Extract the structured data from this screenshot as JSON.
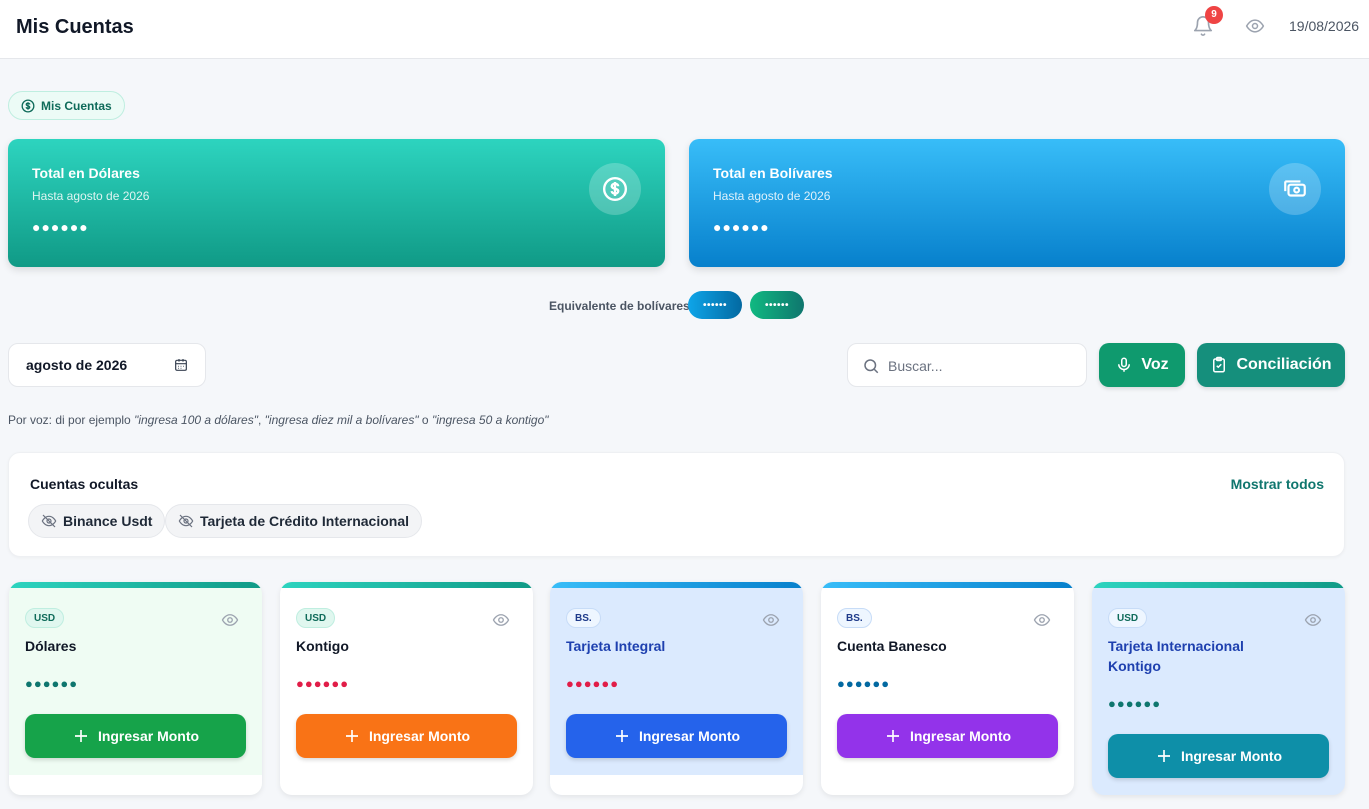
{
  "header": {
    "title": "Mis Cuentas",
    "notification_count": "9",
    "date": "19/08/2026"
  },
  "section_chip": {
    "label": "Mis Cuentas"
  },
  "totals": {
    "usd": {
      "title": "Total en Dólares",
      "subtitle": "Hasta agosto de 2026",
      "value": "●●●●●●"
    },
    "bs": {
      "title": "Total en Bolívares",
      "subtitle": "Hasta agosto de 2026",
      "value": "●●●●●●"
    }
  },
  "equivalent": {
    "label": "Equivalente de bolívares",
    "pill_a": "••••••",
    "pill_b": "••••••"
  },
  "toolbar": {
    "month": "agosto de 2026",
    "search_placeholder": "Buscar...",
    "voice_label": "Voz",
    "reconcile_label": "Conciliación"
  },
  "hint": {
    "prefix": "Por voz: di por ejemplo ",
    "ex1": "\"ingresa 100 a dólares\"",
    "sep1": ", ",
    "ex2": "\"ingresa diez mil a bolívares\"",
    "sep2": " o ",
    "ex3": "\"ingresa 50 a kontigo\""
  },
  "hidden_accounts": {
    "title": "Cuentas ocultas",
    "show_all": "Mostrar todos",
    "items": [
      "Binance Usdt",
      "Tarjeta de Crédito Internacional"
    ]
  },
  "accounts": [
    {
      "currency": "USD",
      "name": "Dólares",
      "value": "●●●●●●",
      "button": "Ingresar Monto"
    },
    {
      "currency": "USD",
      "name": "Kontigo",
      "value": "●●●●●●",
      "button": "Ingresar Monto"
    },
    {
      "currency": "BS.",
      "name": "Tarjeta Integral",
      "value": "●●●●●●",
      "button": "Ingresar Monto"
    },
    {
      "currency": "BS.",
      "name": "Cuenta Banesco",
      "value": "●●●●●●",
      "button": "Ingresar Monto"
    },
    {
      "currency": "USD",
      "name": "Tarjeta Internacional Kontigo",
      "value": "●●●●●●",
      "button": "Ingresar Monto"
    }
  ],
  "colors": {
    "primary_green": "#0f9a6e",
    "teal": "#158f7c",
    "btn_green": "#16a34a",
    "btn_orange": "#f97316",
    "btn_blue": "#2563eb",
    "btn_purple": "#9333ea",
    "btn_cyan": "#0e8fa8"
  }
}
